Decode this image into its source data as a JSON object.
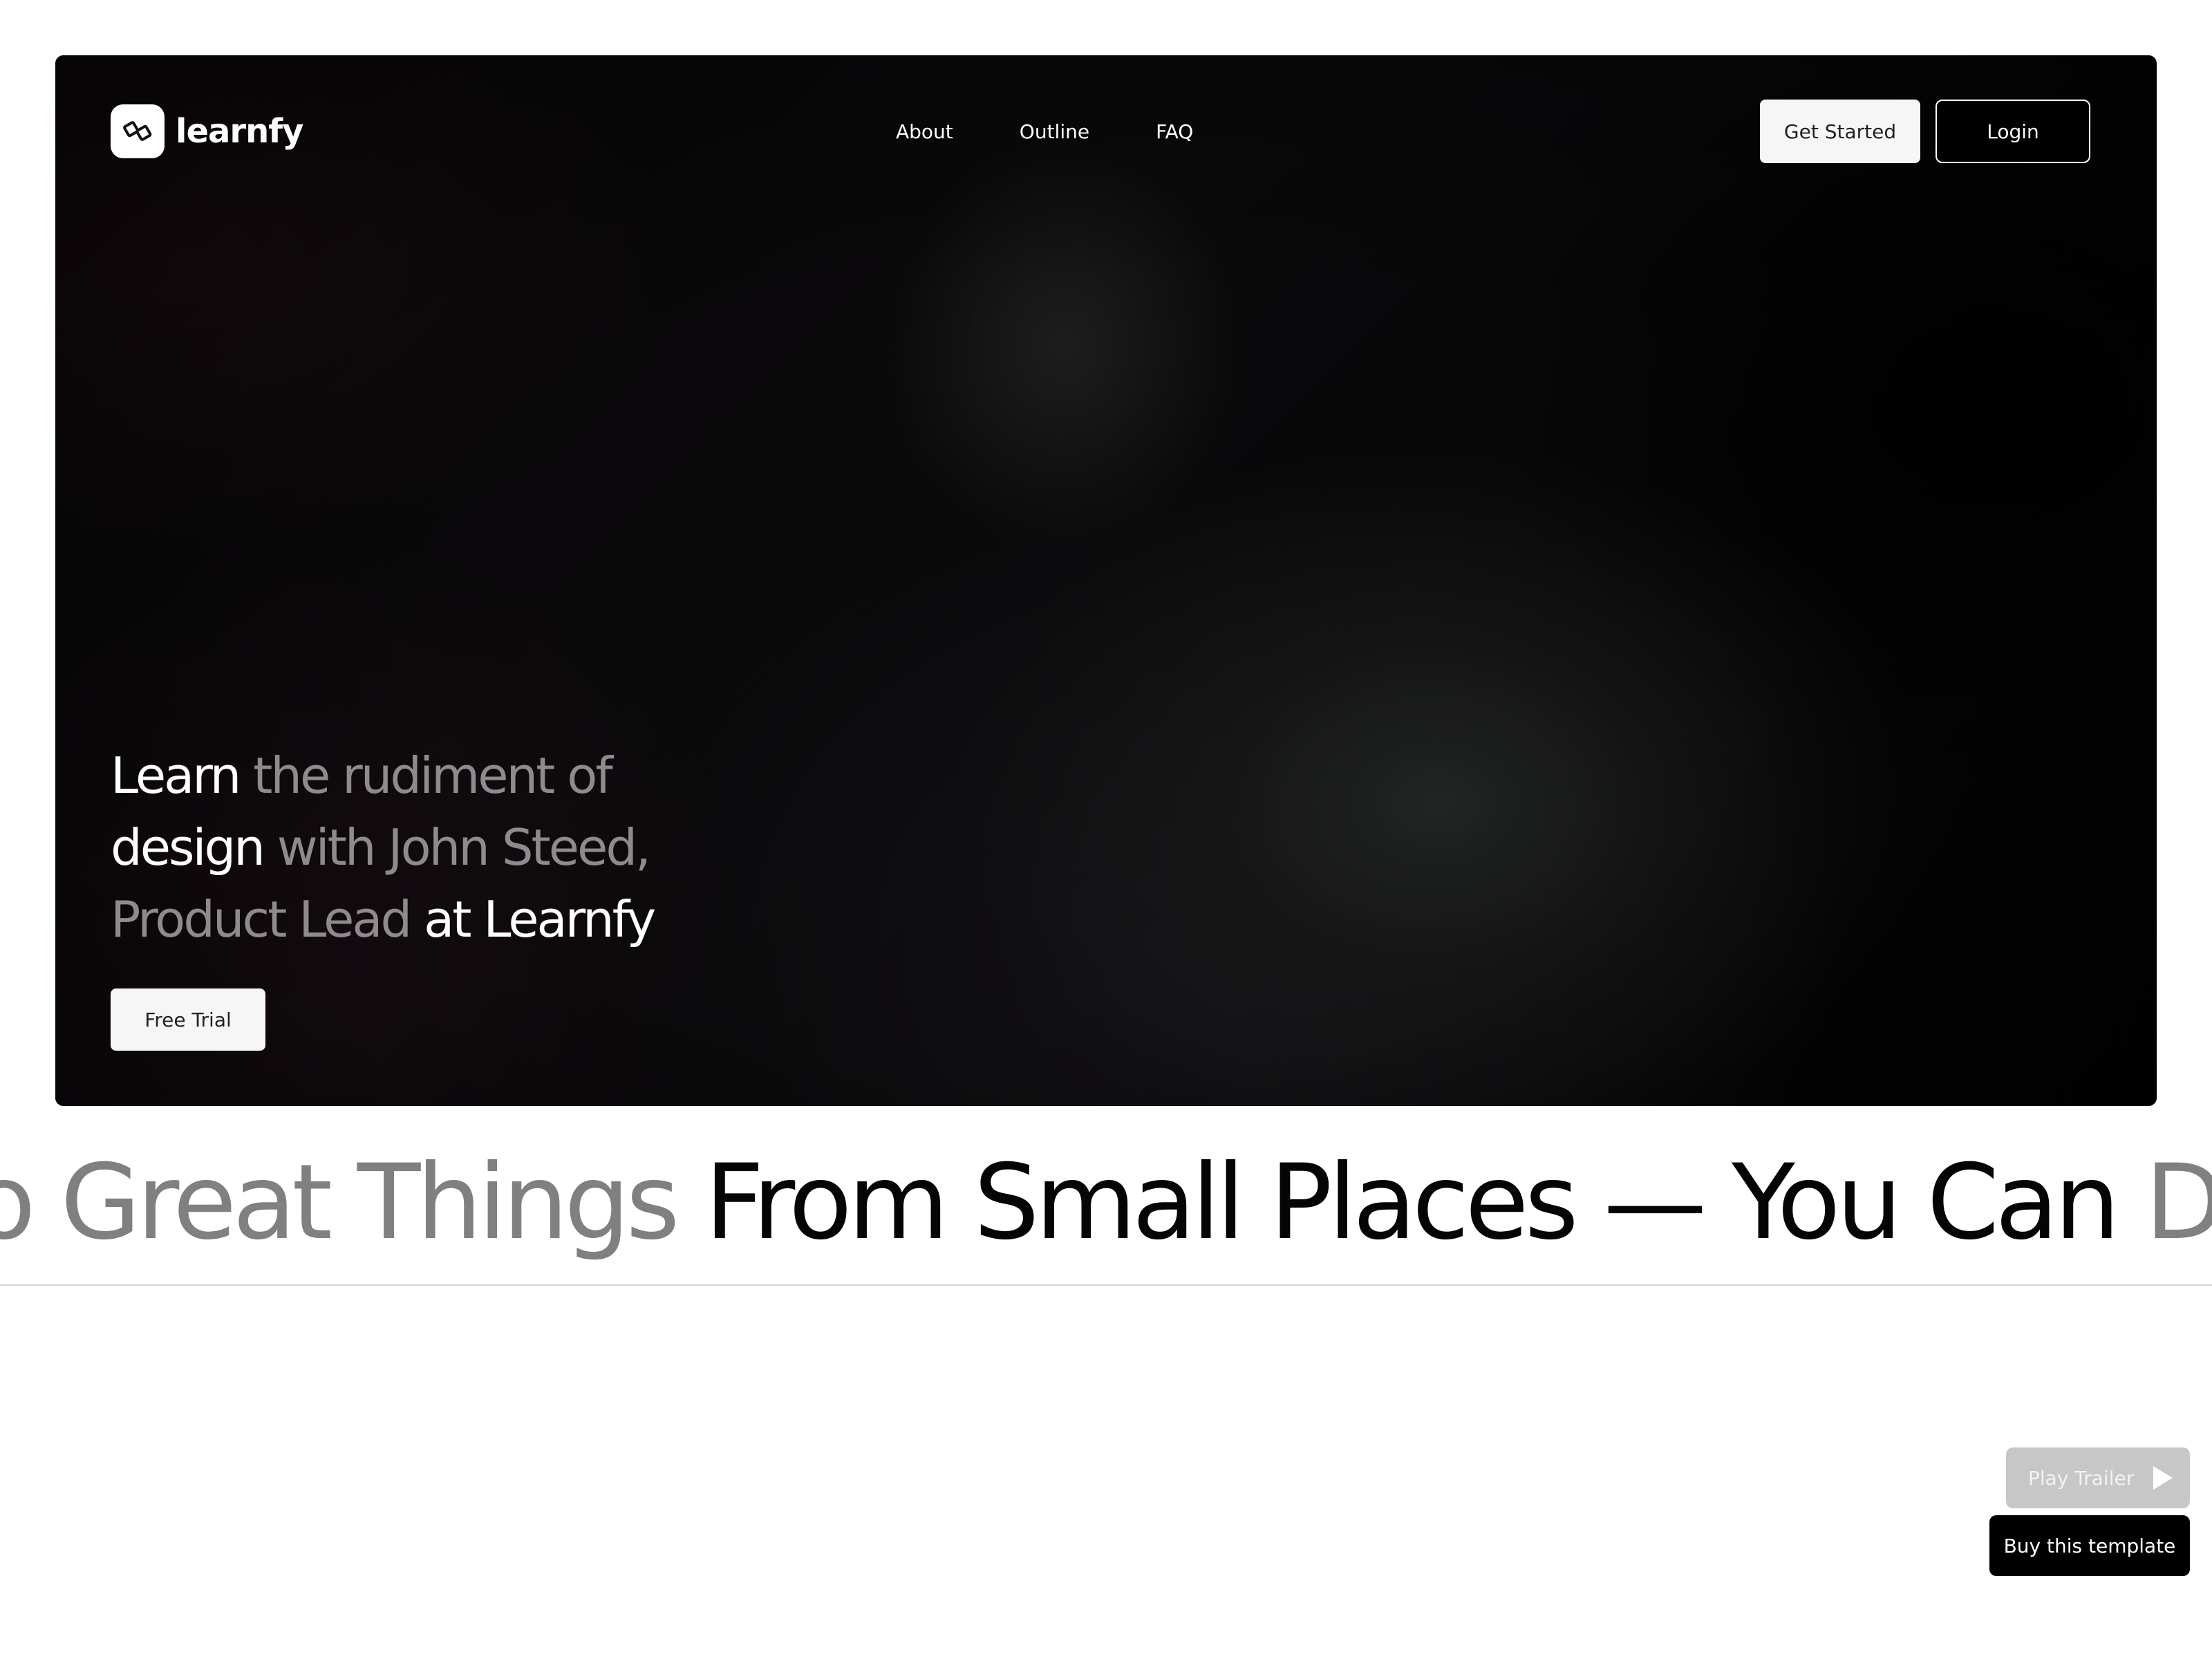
{
  "brand": {
    "name": "learnfy",
    "logo_icon": "learnfy-logo-icon"
  },
  "nav": {
    "links": [
      "About",
      "Outline",
      "FAQ"
    ],
    "get_started_label": "Get Started",
    "login_label": "Login"
  },
  "hero": {
    "headline": [
      {
        "text": "Learn ",
        "style": "white"
      },
      {
        "text": "the rudiment of",
        "style": "grey"
      },
      {
        "text": "design ",
        "style": "white"
      },
      {
        "text": "with John Steed,",
        "style": "grey"
      },
      {
        "text": "Product Lead ",
        "style": "grey"
      },
      {
        "text": "at Learnfy",
        "style": "white"
      }
    ],
    "cta_label": "Free Trial"
  },
  "marquee": {
    "segments": [
      {
        "text": "o Great Things ",
        "style": "grey"
      },
      {
        "text": "From Small Places — You Can ",
        "style": "black"
      },
      {
        "text": "Do G",
        "style": "grey"
      }
    ]
  },
  "floating": {
    "play_trailer_label": "Play Trailer",
    "play_icon": "play-icon",
    "buy_label": "Buy this template"
  },
  "colors": {
    "hero_bg": "#050406",
    "headline_white": "#ffffff",
    "headline_grey": "#8e8a8d",
    "marquee_grey": "#808080",
    "marquee_black": "#050505",
    "trailer_bg": "#c7c7c7",
    "buy_bg": "#000000"
  }
}
